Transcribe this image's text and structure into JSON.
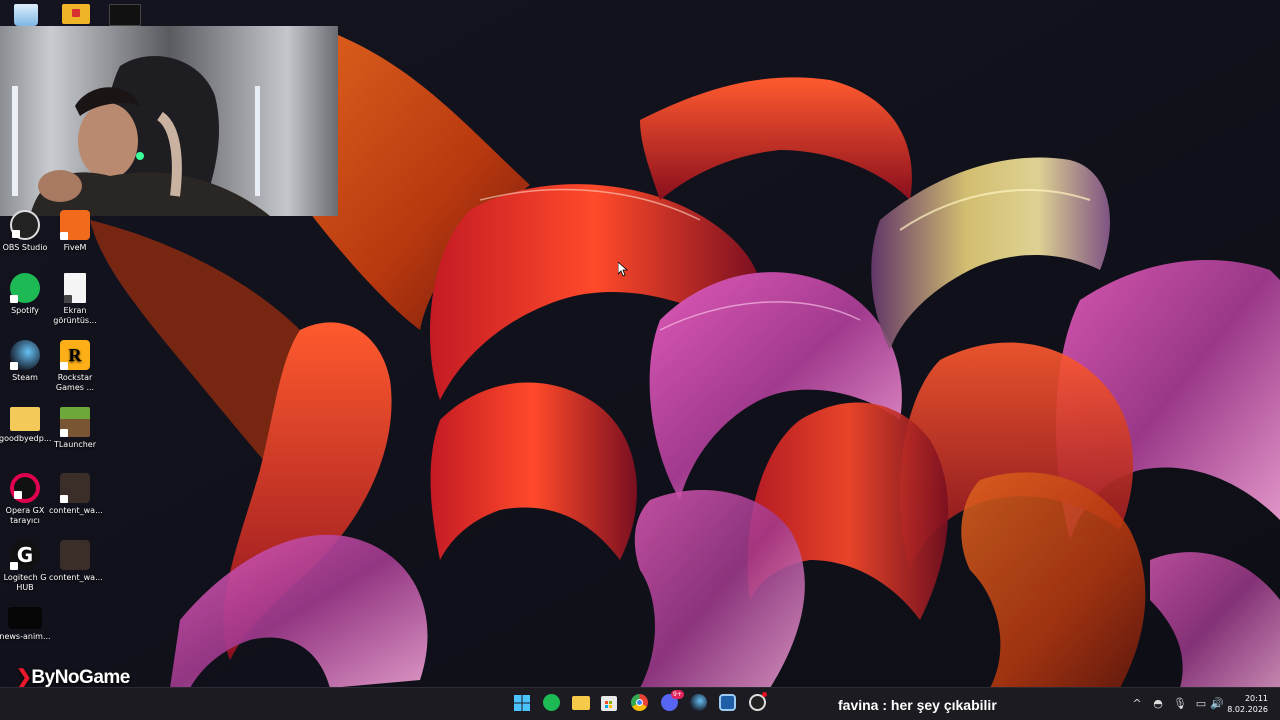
{
  "desktop": {
    "icons": [
      {
        "name": "recycle-bin",
        "label": "",
        "color": "#4aa3df"
      },
      {
        "name": "folder-top",
        "label": "",
        "color": "#f0b429"
      },
      {
        "name": "video-thumb-top",
        "label": "",
        "color": "#222"
      },
      {
        "name": "obs-studio",
        "label": "OBS Studio",
        "color": "#303030"
      },
      {
        "name": "fivem",
        "label": "FiveM",
        "color": "#f26b1d"
      },
      {
        "name": "spotify",
        "label": "Spotify",
        "color": "#1db954"
      },
      {
        "name": "ekran-goruntusu",
        "label": "Ekran görüntüs...",
        "color": "#f5f5f5"
      },
      {
        "name": "steam",
        "label": "Steam",
        "color": "#1b2838"
      },
      {
        "name": "rockstar",
        "label": "Rockstar Games ...",
        "color": "#fcaf17"
      },
      {
        "name": "goodbyedpi",
        "label": "goodbyedp...",
        "color": "#f3c95a"
      },
      {
        "name": "tlauncher",
        "label": "TLauncher",
        "color": "#5a8a32"
      },
      {
        "name": "opera-gx",
        "label": "Opera GX tarayıcı",
        "color": "#e0004e"
      },
      {
        "name": "content-warning-1",
        "label": "content_wa...",
        "color": "#3b2e28"
      },
      {
        "name": "logitech-ghub",
        "label": "Logitech G HUB",
        "color": "#111"
      },
      {
        "name": "content-warning-2",
        "label": "content_wa...",
        "color": "#3b2e28"
      },
      {
        "name": "news-animation",
        "label": "news-anim...",
        "color": "#050505"
      }
    ]
  },
  "overlay": {
    "brand": "ByNoGame",
    "chat_user": "favina",
    "chat_separator": " : ",
    "chat_message": "her şey çıkabilir"
  },
  "taskbar": {
    "apps": [
      "windows-start",
      "spotify",
      "file-explorer",
      "microsoft-store",
      "chrome",
      "discord",
      "steam",
      "steam-vr",
      "obs"
    ],
    "discord_badge": "9+",
    "tray_chevron": "^"
  },
  "clock": {
    "time": "20:11",
    "date": "8.02.2026"
  }
}
